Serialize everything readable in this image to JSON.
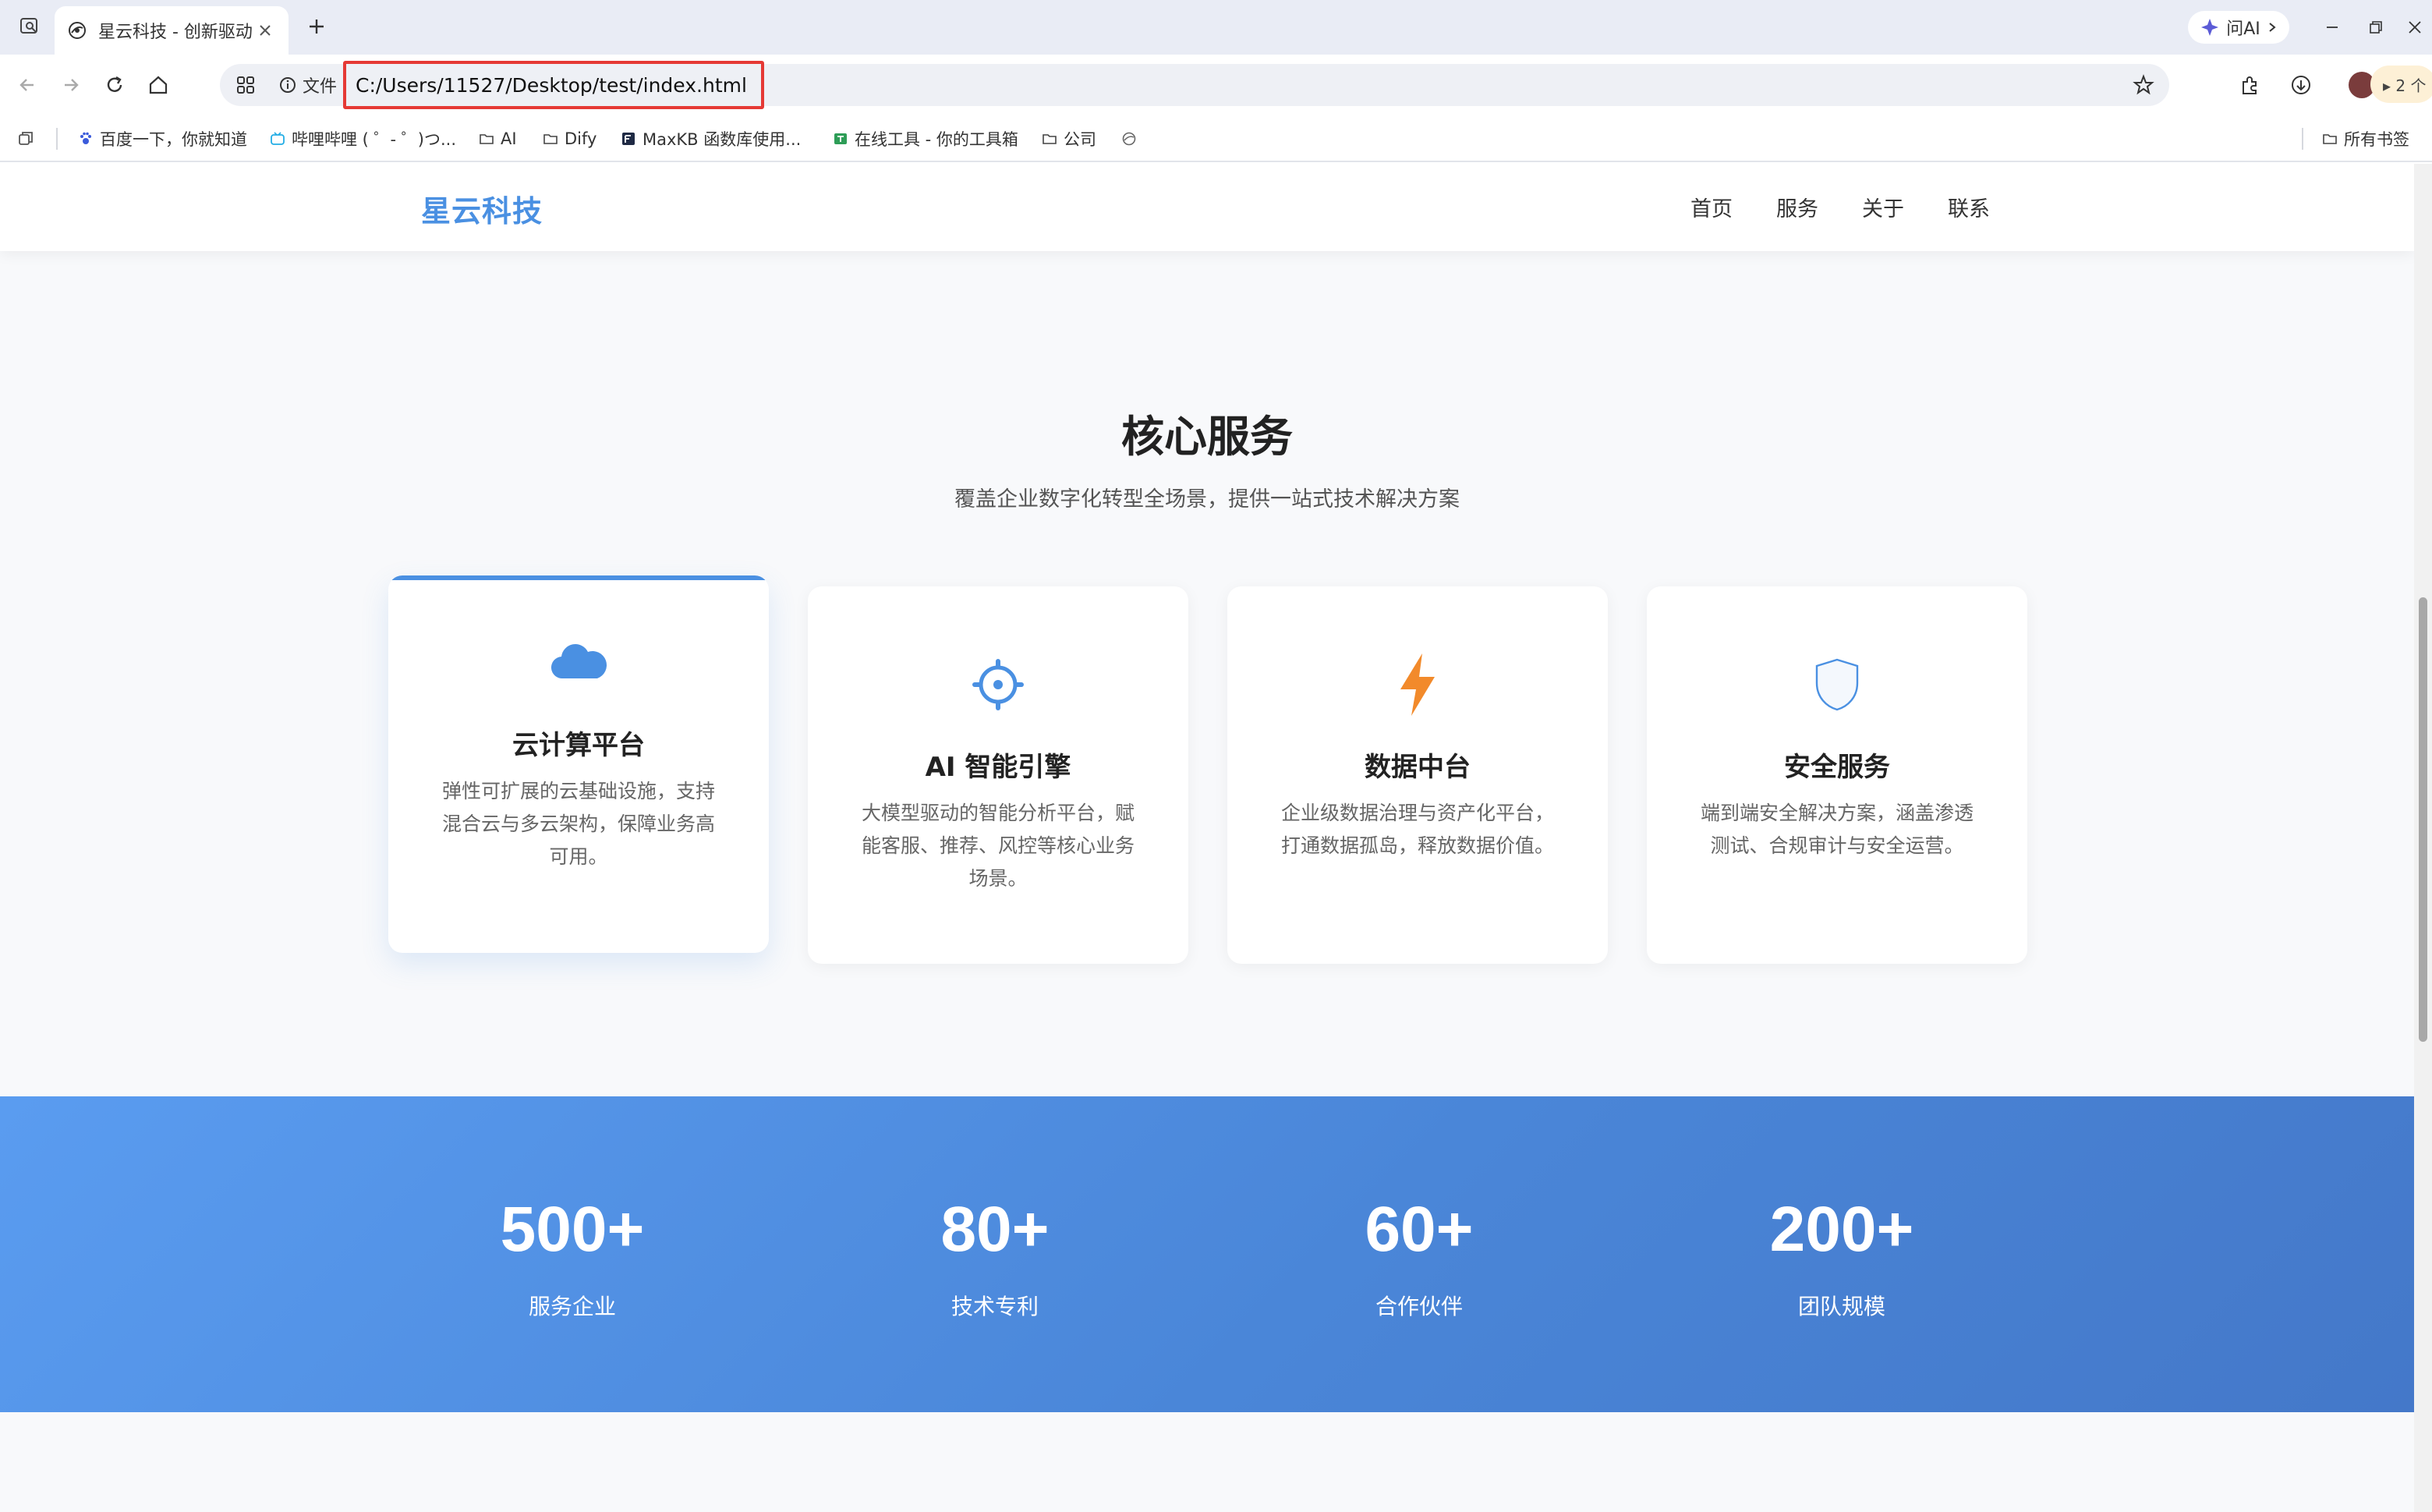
{
  "browser": {
    "tab_title": "星云科技 - 创新驱动",
    "ask_ai_label": "问AI",
    "file_chip_label": "文件",
    "url": "C:/Users/11527/Desktop/test/index.html",
    "profile_badge": "▸ 2 个",
    "accent_highlight": "#e53935"
  },
  "bookmarks": {
    "items": [
      {
        "label": "百度一下，你就知道",
        "icon": "paw-icon"
      },
      {
        "label": "哔哩哔哩 ( ゜- ゜)つ...",
        "icon": "tv-icon"
      },
      {
        "label": "AI",
        "icon": "folder-icon"
      },
      {
        "label": "Dify",
        "icon": "folder-icon"
      },
      {
        "label": "MaxKB 函数库使用...",
        "icon": "doc-icon"
      },
      {
        "label": "在线工具 - 你的工具箱",
        "icon": "toolbox-icon"
      },
      {
        "label": "公司",
        "icon": "folder-icon"
      }
    ],
    "all_bookmarks_label": "所有书签"
  },
  "site": {
    "brand": "星云科技",
    "brand_color": "#4a90e2",
    "nav": [
      "首页",
      "服务",
      "关于",
      "联系"
    ]
  },
  "services": {
    "title": "核心服务",
    "subtitle": "覆盖企业数字化转型全场景，提供一站式技术解决方案",
    "cards": [
      {
        "icon": "cloud-icon",
        "title": "云计算平台",
        "desc": "弹性可扩展的云基础设施，支持混合云与多云架构，保障业务高可用。"
      },
      {
        "icon": "gear-icon",
        "title": "AI 智能引擎",
        "desc": "大模型驱动的智能分析平台，赋能客服、推荐、风控等核心业务场景。"
      },
      {
        "icon": "lightning-icon",
        "title": "数据中台",
        "desc": "企业级数据治理与资产化平台，打通数据孤岛，释放数据价值。"
      },
      {
        "icon": "shield-icon",
        "title": "安全服务",
        "desc": "端到端安全解决方案，涵盖渗透测试、合规审计与安全运营。"
      }
    ]
  },
  "stats": [
    {
      "value": "500+",
      "label": "服务企业"
    },
    {
      "value": "80+",
      "label": "技术专利"
    },
    {
      "value": "60+",
      "label": "合作伙伴"
    },
    {
      "value": "200+",
      "label": "团队规模"
    }
  ]
}
